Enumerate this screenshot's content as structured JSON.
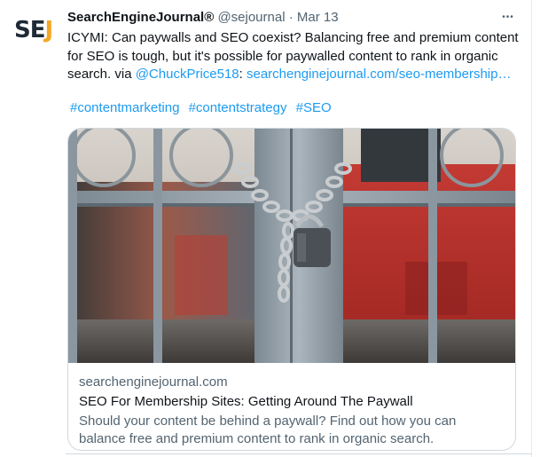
{
  "tweet": {
    "avatar_text_se": "SE",
    "avatar_text_j": "J",
    "display_name": "SearchEngineJournal®",
    "handle": "@sejournal",
    "separator": "·",
    "date": "Mar 13",
    "more_label": "•••",
    "body_text": "ICYMI: Can paywalls and SEO coexist? Balancing free and premium content for SEO is tough, but it's possible for paywalled content to rank in organic search. via ",
    "mention": "@ChuckPrice518",
    "mention_suffix": ": ",
    "url": "searchenginejournal.com/seo-membership…",
    "hashtags": [
      "#contentmarketing",
      "#contentstrategy",
      "#SEO"
    ]
  },
  "card": {
    "domain": "searchenginejournal.com",
    "title": "SEO For Membership Sites: Getting Around The Paywall",
    "description": "Should your content be behind a paywall? Find out how you can balance free and premium content to rank in organic search."
  },
  "colors": {
    "link": "#1d9bf0",
    "secondary_text": "#536471",
    "brand_dark": "#1f2a37",
    "brand_orange": "#f5a623"
  },
  "icons": {
    "more": "more-dots-icon",
    "image": "padlock-chain-gate-photo"
  }
}
